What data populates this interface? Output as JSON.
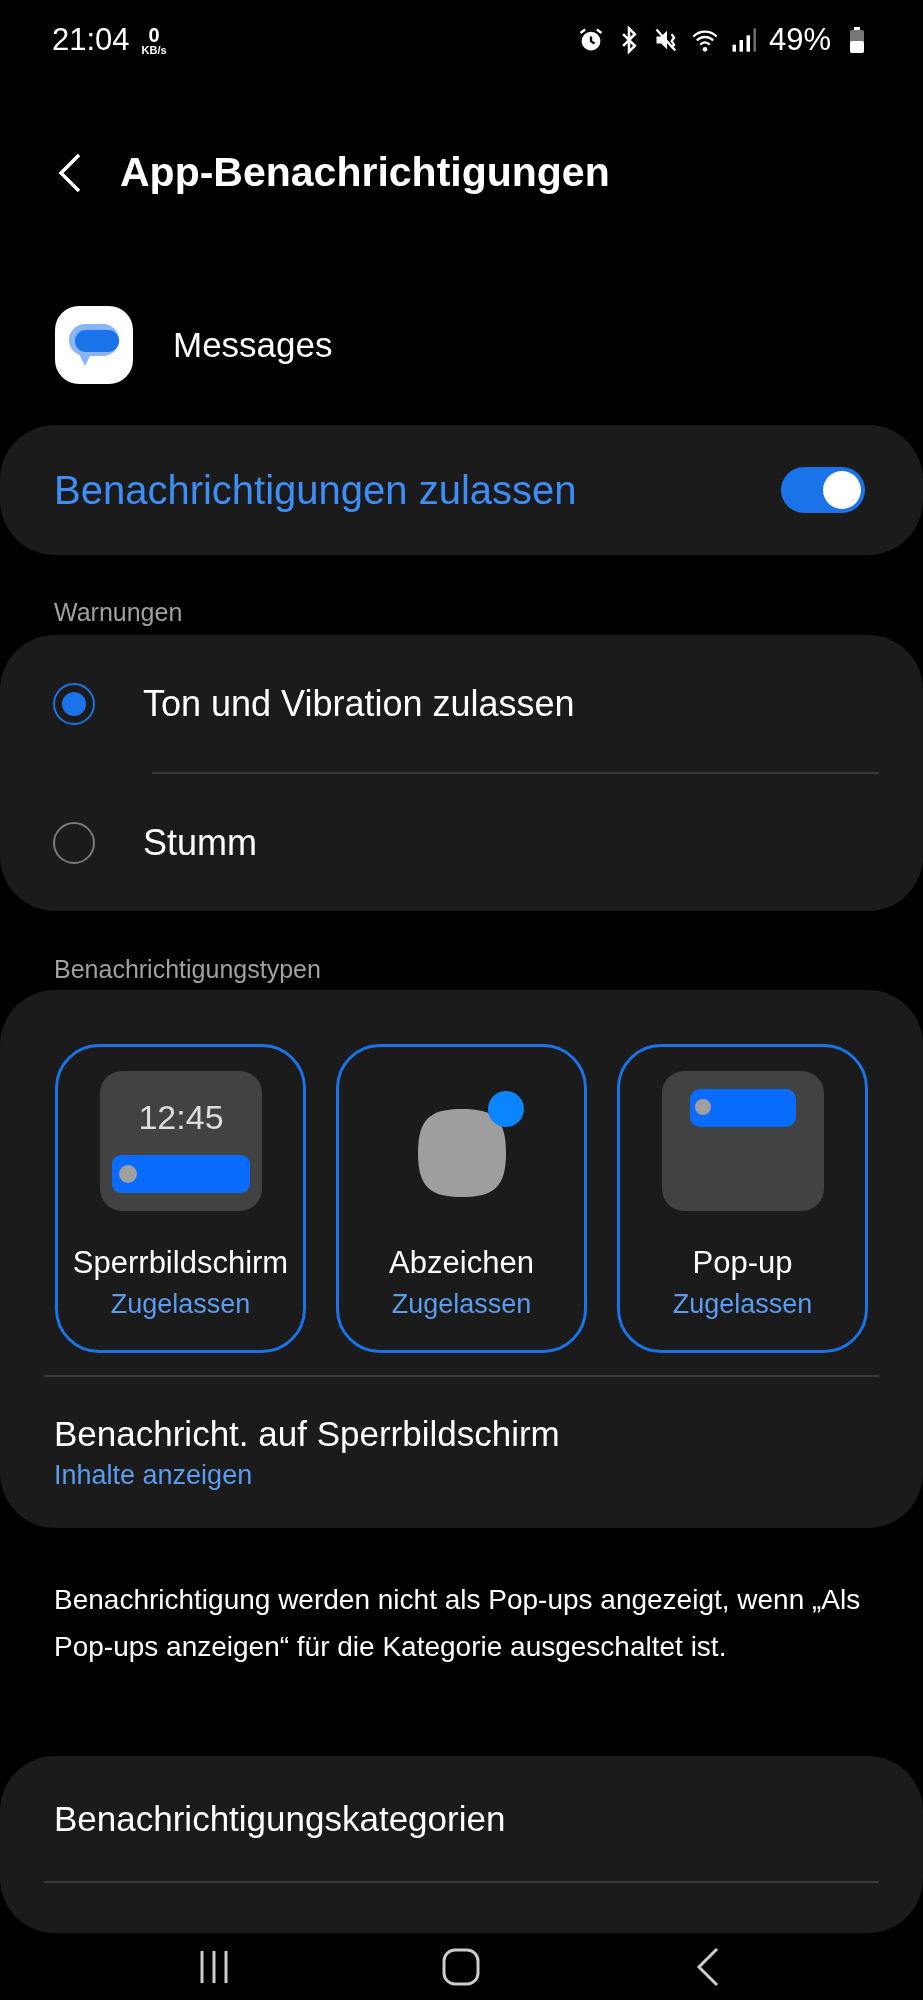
{
  "status_bar": {
    "time": "21:04",
    "speed_value": "0",
    "speed_unit": "KB/s",
    "battery": "49%"
  },
  "header": {
    "title": "App-Benachrichtigungen"
  },
  "app": {
    "name": "Messages"
  },
  "allow_notifications": {
    "label": "Benachrichtigungen zulassen",
    "on": true
  },
  "alerts": {
    "heading": "Warnungen",
    "options": [
      {
        "label": "Ton und Vibration zulassen",
        "selected": true
      },
      {
        "label": "Stumm",
        "selected": false
      }
    ]
  },
  "types": {
    "heading": "Benachrichtigungstypen",
    "tiles": [
      {
        "kind": "lockscreen",
        "label": "Sperrbildschirm",
        "status": "Zugelassen",
        "selected": true,
        "time": "12:45"
      },
      {
        "kind": "badge",
        "label": "Abzeichen",
        "status": "Zugelassen",
        "selected": true
      },
      {
        "kind": "popup",
        "label": "Pop-up",
        "status": "Zugelassen",
        "selected": true
      }
    ],
    "lockscreen_row": {
      "title": "Benachricht. auf Sperrbildschirm",
      "value": "Inhalte anzeigen"
    }
  },
  "note": "Benachrichtigung werden nicht als Pop-ups angezeigt, wenn „Als Pop-ups anzeigen“ für die Kategorie ausgeschaltet ist.",
  "categories": {
    "items": [
      "Benachrichtigungskategorien"
    ]
  }
}
